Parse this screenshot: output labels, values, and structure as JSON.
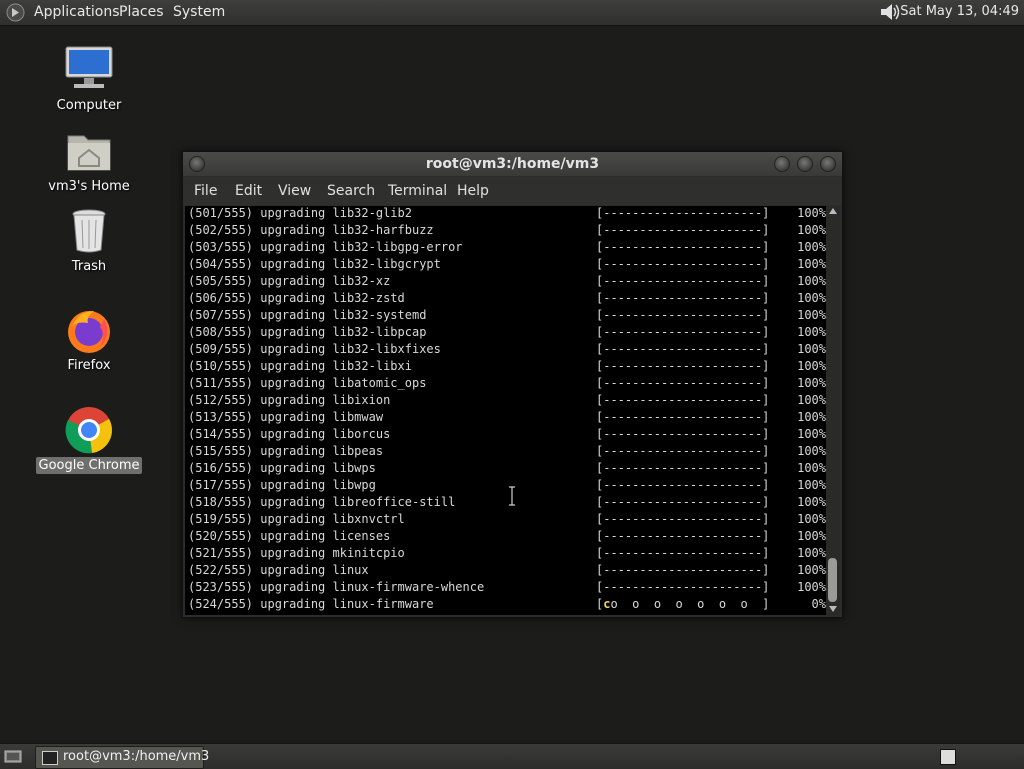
{
  "top_panel": {
    "menus": [
      "Applications",
      "Places",
      "System"
    ],
    "clock": "Sat May 13, 04:49",
    "volume_icon": "speaker-icon"
  },
  "desktop_icons": [
    {
      "label": "Computer",
      "icon": "computer-icon"
    },
    {
      "label": "vm3's Home",
      "icon": "home-folder-icon"
    },
    {
      "label": "Trash",
      "icon": "trash-icon"
    },
    {
      "label": "Firefox",
      "icon": "firefox-icon"
    },
    {
      "label": "Google Chrome",
      "icon": "chrome-icon"
    }
  ],
  "window": {
    "title": "root@vm3:/home/vm3",
    "menu": [
      "File",
      "Edit",
      "View",
      "Search",
      "Terminal",
      "Help"
    ]
  },
  "terminal": {
    "lines": [
      {
        "text": "(501/555) upgrading lib32-glib2",
        "bar": "[----------------------]",
        "pct": "100%"
      },
      {
        "text": "(502/555) upgrading lib32-harfbuzz",
        "bar": "[----------------------]",
        "pct": "100%"
      },
      {
        "text": "(503/555) upgrading lib32-libgpg-error",
        "bar": "[----------------------]",
        "pct": "100%"
      },
      {
        "text": "(504/555) upgrading lib32-libgcrypt",
        "bar": "[----------------------]",
        "pct": "100%"
      },
      {
        "text": "(505/555) upgrading lib32-xz",
        "bar": "[----------------------]",
        "pct": "100%"
      },
      {
        "text": "(506/555) upgrading lib32-zstd",
        "bar": "[----------------------]",
        "pct": "100%"
      },
      {
        "text": "(507/555) upgrading lib32-systemd",
        "bar": "[----------------------]",
        "pct": "100%"
      },
      {
        "text": "(508/555) upgrading lib32-libpcap",
        "bar": "[----------------------]",
        "pct": "100%"
      },
      {
        "text": "(509/555) upgrading lib32-libxfixes",
        "bar": "[----------------------]",
        "pct": "100%"
      },
      {
        "text": "(510/555) upgrading lib32-libxi",
        "bar": "[----------------------]",
        "pct": "100%"
      },
      {
        "text": "(511/555) upgrading libatomic_ops",
        "bar": "[----------------------]",
        "pct": "100%"
      },
      {
        "text": "(512/555) upgrading libixion",
        "bar": "[----------------------]",
        "pct": "100%"
      },
      {
        "text": "(513/555) upgrading libmwaw",
        "bar": "[----------------------]",
        "pct": "100%"
      },
      {
        "text": "(514/555) upgrading liborcus",
        "bar": "[----------------------]",
        "pct": "100%"
      },
      {
        "text": "(515/555) upgrading libpeas",
        "bar": "[----------------------]",
        "pct": "100%"
      },
      {
        "text": "(516/555) upgrading libwps",
        "bar": "[----------------------]",
        "pct": "100%"
      },
      {
        "text": "(517/555) upgrading libwpg",
        "bar": "[----------------------]",
        "pct": "100%"
      },
      {
        "text": "(518/555) upgrading libreoffice-still",
        "bar": "[----------------------]",
        "pct": "100%"
      },
      {
        "text": "(519/555) upgrading libxnvctrl",
        "bar": "[----------------------]",
        "pct": "100%"
      },
      {
        "text": "(520/555) upgrading licenses",
        "bar": "[----------------------]",
        "pct": "100%"
      },
      {
        "text": "(521/555) upgrading mkinitcpio",
        "bar": "[----------------------]",
        "pct": "100%"
      },
      {
        "text": "(522/555) upgrading linux",
        "bar": "[----------------------]",
        "pct": "100%"
      },
      {
        "text": "(523/555) upgrading linux-firmware-whence",
        "bar": "[----------------------]",
        "pct": "100%"
      },
      {
        "text": "(524/555) upgrading linux-firmware",
        "bar_cursor": "c",
        "bar_rest": "o  o  o  o  o  o  o  ]",
        "bar_open": "[",
        "pct": "0%"
      }
    ]
  },
  "taskbar": {
    "task_label": "root@vm3:/home/vm3"
  },
  "colors": {
    "desktop_bg": "#1c1d1b",
    "terminal_bg": "#000000",
    "terminal_fg": "#d8d8d8",
    "pacman_cursor": "#f0d060"
  }
}
